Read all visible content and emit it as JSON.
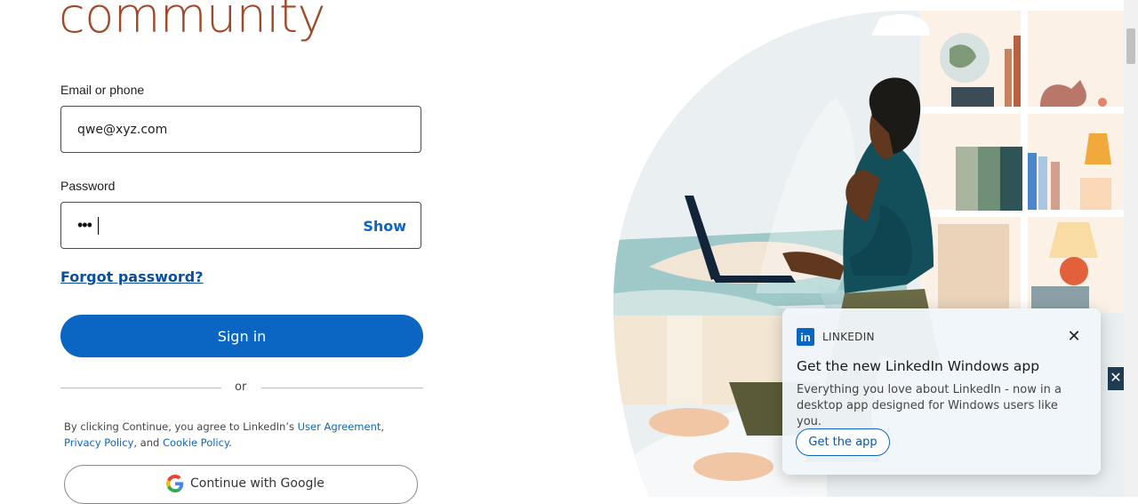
{
  "headline": "community",
  "form": {
    "email_label": "Email or phone",
    "email_value": "qwe@xyz.com",
    "password_label": "Password",
    "password_mask": "•••",
    "show_label": "Show",
    "forgot_label": "Forgot password?",
    "signin_label": "Sign in",
    "or_label": "or"
  },
  "legal": {
    "prefix": "By clicking Continue, you agree to LinkedIn’s ",
    "user_agreement": "User Agreement",
    "comma": ", ",
    "privacy_policy": "Privacy Policy",
    "and": ", and ",
    "cookie_policy": "Cookie Policy",
    "end": "."
  },
  "google_button": {
    "label": "Continue with Google",
    "icon": "google-g-icon"
  },
  "toast": {
    "logo_text": "in",
    "brand": "LINKEDIN",
    "close_glyph": "✕",
    "title": "Get the new LinkedIn Windows app",
    "body": "Everything you love about LinkedIn - now in a desktop app designed for Windows users like you.",
    "cta": "Get the app"
  },
  "side_close_glyph": "✕",
  "colors": {
    "primary": "#0a66c2",
    "headline": "#a0482a"
  }
}
